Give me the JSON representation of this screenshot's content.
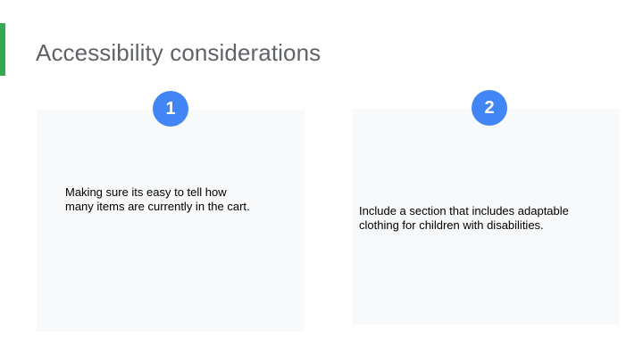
{
  "slide": {
    "title": "Accessibility considerations",
    "accent_color": "#34a853"
  },
  "cards": [
    {
      "number": "1",
      "text": "Making sure its easy to tell how many items are currently in the cart."
    },
    {
      "number": "2",
      "text": "Include a section that includes adaptable clothing for children with disabilities."
    }
  ],
  "colors": {
    "badge": "#4285f4",
    "card_background": "#f8f9fa",
    "title": "#5f6368"
  }
}
